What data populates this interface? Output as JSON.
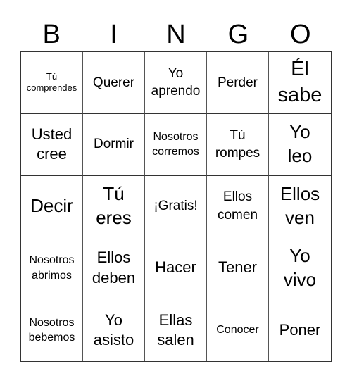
{
  "header": {
    "letters": [
      "B",
      "I",
      "N",
      "G",
      "O"
    ]
  },
  "cells": [
    {
      "text": "Tú\ncomprendes",
      "size": "s-xs"
    },
    {
      "text": "Querer",
      "size": "s-m"
    },
    {
      "text": "Yo\naprendo",
      "size": "s-m"
    },
    {
      "text": "Perder",
      "size": "s-m"
    },
    {
      "text": "Él\nsabe",
      "size": "s-xxl"
    },
    {
      "text": "Usted\ncree",
      "size": "s-l"
    },
    {
      "text": "Dormir",
      "size": "s-m"
    },
    {
      "text": "Nosotros\ncorremos",
      "size": "s-s"
    },
    {
      "text": "Tú\nrompes",
      "size": "s-m"
    },
    {
      "text": "Yo\nleo",
      "size": "s-xl"
    },
    {
      "text": "Decir",
      "size": "s-xl"
    },
    {
      "text": "Tú\neres",
      "size": "s-xl"
    },
    {
      "text": "¡Gratis!",
      "size": "s-m"
    },
    {
      "text": "Ellos\ncomen",
      "size": "s-m"
    },
    {
      "text": "Ellos\nven",
      "size": "s-xl"
    },
    {
      "text": "Nosotros\nabrimos",
      "size": "s-s"
    },
    {
      "text": "Ellos\ndeben",
      "size": "s-l"
    },
    {
      "text": "Hacer",
      "size": "s-l"
    },
    {
      "text": "Tener",
      "size": "s-l"
    },
    {
      "text": "Yo\nvivo",
      "size": "s-xl"
    },
    {
      "text": "Nosotros\nbebemos",
      "size": "s-s"
    },
    {
      "text": "Yo\nasisto",
      "size": "s-l"
    },
    {
      "text": "Ellas\nsalen",
      "size": "s-l"
    },
    {
      "text": "Conocer",
      "size": "s-s"
    },
    {
      "text": "Poner",
      "size": "s-l"
    }
  ]
}
